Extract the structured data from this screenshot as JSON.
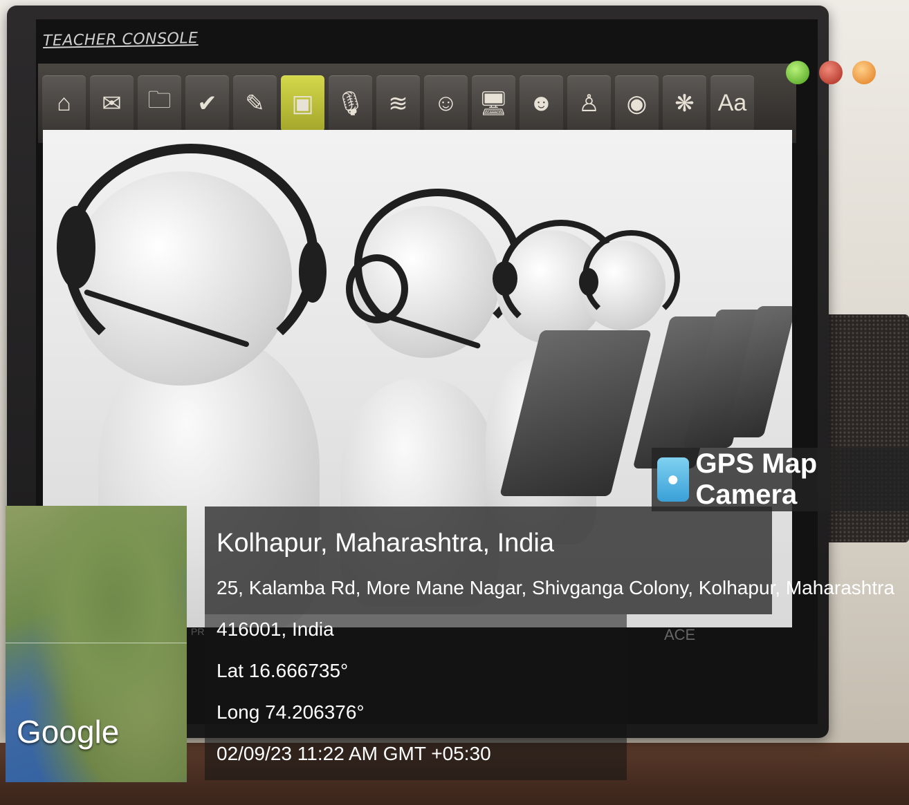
{
  "console": {
    "title": "TEACHER CONSOLE"
  },
  "toolbar": {
    "tools": [
      {
        "icon": "home-icon",
        "glyph": "⌂"
      },
      {
        "icon": "assignment-icon",
        "glyph": "✉"
      },
      {
        "icon": "folder-icon",
        "glyph": "🗀"
      },
      {
        "icon": "check-icon",
        "glyph": "✔"
      },
      {
        "icon": "chat-icon",
        "glyph": "✎"
      },
      {
        "icon": "presentation-icon",
        "glyph": "▣"
      },
      {
        "icon": "microphone-icon",
        "glyph": "🎙"
      },
      {
        "icon": "audio-meter-icon",
        "glyph": "≋"
      },
      {
        "icon": "student-icon",
        "glyph": "☺"
      },
      {
        "icon": "computer-icon",
        "glyph": "🖥"
      },
      {
        "icon": "user-chat-icon",
        "glyph": "☻"
      },
      {
        "icon": "teacher-icon",
        "glyph": "♙"
      },
      {
        "icon": "camera-icon",
        "glyph": "◉"
      },
      {
        "icon": "colors-icon",
        "glyph": "❋"
      },
      {
        "icon": "font-icon",
        "glyph": "Aa"
      }
    ]
  },
  "colors": {
    "stamp_bg": "#282828",
    "text": "#ffffff"
  },
  "stamp": {
    "brand": "GPS Map Camera",
    "place": "Kolhapur, Maharashtra, India",
    "address_line1": "25, Kalamba Rd, More Mane Nagar, Shivganga Colony, Kolhapur, Maharashtra",
    "address_line2": "416001, India",
    "lat": "Lat 16.666735°",
    "long": "Long 74.206376°",
    "datetime": "02/09/23 11:22 AM GMT +05:30"
  },
  "map": {
    "provider": "Google"
  },
  "bottom_bar": {
    "left_fragment": "PR",
    "center_fragment": "ACE"
  }
}
